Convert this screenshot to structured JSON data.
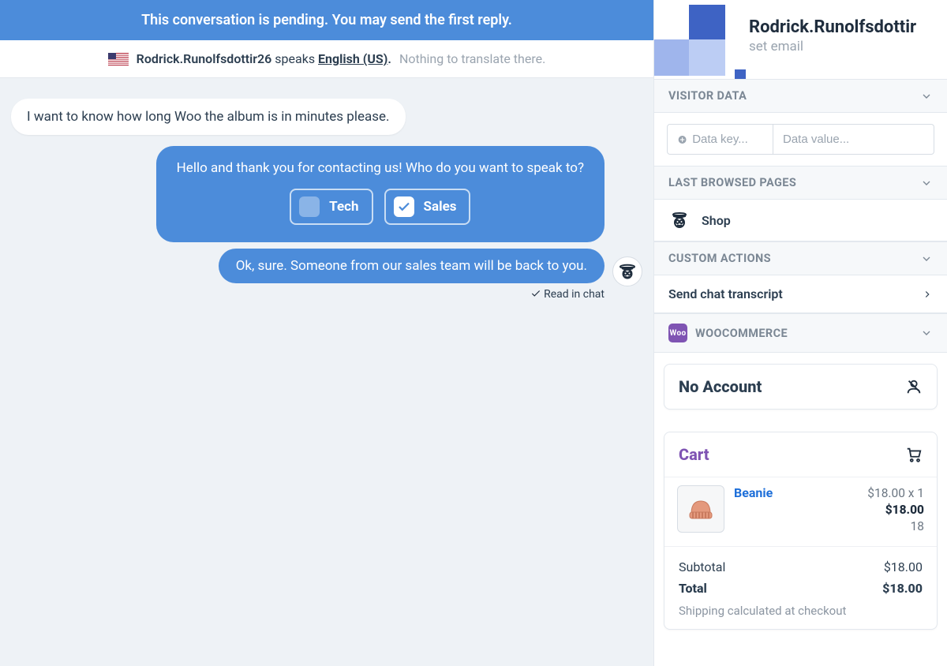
{
  "banner": "This conversation is pending. You may send the first reply.",
  "langbar": {
    "who": "Rodrick.Runolfsdottir26",
    "verb": "speaks",
    "lang": "English (US)",
    "punct": ".",
    "note": "Nothing to translate there."
  },
  "messages": {
    "visitor1": "I want to know how long Woo the album is in minutes please.",
    "agent1_prompt": "Hello and thank you for contacting us! Who do you want to speak to?",
    "choice_tech": "Tech",
    "choice_sales": "Sales",
    "agent2": "Ok, sure. Someone from our sales team will be back to you.",
    "read_status": "Read in chat"
  },
  "sidebar": {
    "visitor_name": "Rodrick.Runolfsdottir",
    "set_email": "set email",
    "sections": {
      "visitor_data": "VISITOR DATA",
      "last_browsed": "LAST BROWSED PAGES",
      "custom_actions": "CUSTOM ACTIONS",
      "woocommerce": "WOOCOMMERCE"
    },
    "data_key_placeholder": "Data key...",
    "data_value_placeholder": "Data value...",
    "browsed_page": "Shop",
    "send_transcript": "Send chat transcript",
    "woo_badge": "Woo",
    "no_account": "No Account",
    "cart_title": "Cart",
    "cart_item": {
      "name": "Beanie",
      "unit": "$18.00 x 1",
      "total": "$18.00",
      "qty": "18"
    },
    "subtotal_label": "Subtotal",
    "subtotal_value": "$18.00",
    "total_label": "Total",
    "total_value": "$18.00",
    "shipping_note": "Shipping calculated at checkout"
  }
}
